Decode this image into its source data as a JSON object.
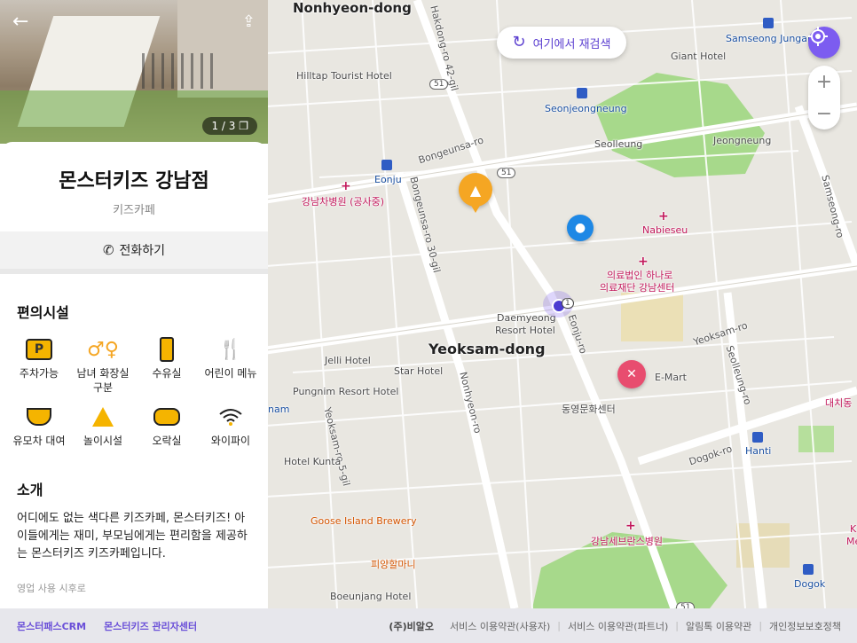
{
  "map": {
    "search_here_label": "여기에서 재검색",
    "zoom_in": "+",
    "zoom_out": "−",
    "labels": {
      "nonhyeon_dong": "Nonhyeon-dong",
      "yeoksam_dong": "Yeoksam-dong",
      "hilltop_tourist_hotel": "Hilltap Tourist Hotel",
      "giant_hotel": "Giant Hotel",
      "samseong_jungang": "Samseong Jungang",
      "seonjeongneung": "Seonjeongneung",
      "seolleung": "Seolleung",
      "jeongneung": "Jeongneung",
      "bongeunsa_ro": "Bongeunsa-ro",
      "eonju": "Eonju",
      "gangnam_cha_hospital": "강남차병원 (공사중)",
      "bongeunsa_ro_30_gil": "Bongeunsa-ro 30-gil",
      "hakdong_ro_42_gil": "Hakdong-ro 42-gil",
      "nabieseu": "Nabieseu",
      "hana_medical_1": "의료법인 하나로",
      "hana_medical_2": "의료재단 강남센터",
      "daemyeong_resort": "Daemyeong",
      "daemyeong_resort_2": "Resort Hotel",
      "eonju_ro": "Eonju-ro",
      "jelli_hotel": "Jelli Hotel",
      "star_hotel": "Star Hotel",
      "pungnim_resort": "Pungnim Resort Hotel",
      "emart": "E-Mart",
      "dongyoung_center": "동영문화센터",
      "yeoksam_ro": "Yeoksam-ro",
      "seolleung_ro": "Seolleung-ro",
      "nonhyeon_ro": "Nonhyeon-ro",
      "yeoksam_ro_5_gil": "Yeoksam-ro 5-gil",
      "hotel_kunta": "Hotel Kunta",
      "dogok_ro": "Dogok-ro",
      "hanti": "Hanti",
      "daechi": "대치동",
      "goose_island": "Goose Island Brewery",
      "piyang_hammani": "피양할마니",
      "gangnam_severance": "강남세브란스병원",
      "boeunjang_hotel": "Boeunjang Hotel",
      "dogok": "Dogok",
      "samseong_ro": "Samseong-ro",
      "nam": "nam",
      "road_51_a": "51",
      "road_51_b": "51",
      "road_51_c": "51",
      "cluster_count": "1",
      "ke": "K",
      "me": "Me"
    }
  },
  "panel": {
    "photo_counter": "1 / 3",
    "place_name": "몬스터키즈 강남점",
    "category": "키즈카페",
    "call_label": "전화하기",
    "amenities_title": "편의시설",
    "amenities": [
      {
        "icon": "parking-icon",
        "label": "주차가능"
      },
      {
        "icon": "restroom-icon",
        "label": "남녀 화장실 구분"
      },
      {
        "icon": "nursing-bottle-icon",
        "label": "수유실"
      },
      {
        "icon": "kids-menu-icon",
        "label": "어린이 메뉴"
      },
      {
        "icon": "stroller-icon",
        "label": "유모차 대여"
      },
      {
        "icon": "playground-icon",
        "label": "놀이시설"
      },
      {
        "icon": "game-controller-icon",
        "label": "오락실"
      },
      {
        "icon": "wifi-icon",
        "label": "와이파이"
      }
    ],
    "intro_title": "소개",
    "intro_text": "어디에도 없는 색다른 키즈카페, 몬스터키즈! 아이들에게는 재미, 부모님에게는 편리함을 제공하는 몬스터키즈 키즈카페입니다.",
    "hours_cut": "영업    사용 시후로"
  },
  "footer": {
    "left_links": [
      "몬스터패스CRM",
      "몬스터키즈 관리자센터"
    ],
    "company": "(주)비알오",
    "right_links": [
      "서비스 이용약관(사용자)",
      "서비스 이용약관(파트너)",
      "알림톡 이용약관",
      "개인정보보호정책"
    ]
  },
  "colors": {
    "accent": "#7c5cf0",
    "pin_orange": "#f5a623",
    "pin_blue": "#1e88e5",
    "pin_pink": "#e84d6f",
    "park_green": "#a7d98b"
  }
}
